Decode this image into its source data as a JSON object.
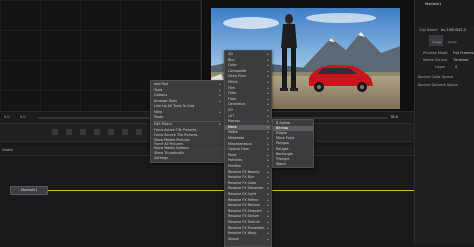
{
  "viewer": {
    "timecode": "78.0",
    "frame_start": "0.0",
    "frame_current": "0.0"
  },
  "inspector": {
    "node_name": "MediaIn1",
    "clip_label": "Clip Name",
    "clip_value": "ec-1000542.3",
    "tab_image": "Image",
    "tab_audio": "Audio",
    "rows": [
      {
        "label": "Process Mode",
        "value": "Full Frames"
      },
      {
        "label": "Media Source",
        "value": "Timeline"
      },
      {
        "label": "Layer",
        "value": "0"
      }
    ],
    "sections": [
      "Source Color Space",
      "Source Gamma Space"
    ]
  },
  "nodes": {
    "header": "Nodes",
    "media_in_label": "MediaIn1"
  },
  "context_menu": {
    "items": [
      {
        "label": "Add Tool",
        "arrow": true
      },
      {
        "label": "Tools",
        "arrow": true
      },
      {
        "label": "Options",
        "arrow": true
      },
      {
        "label": "Arrange Tools",
        "arrow": true
      },
      {
        "label": "Line Up All Tools To Grid",
        "arrow": false
      },
      {
        "label": "View",
        "arrow": true
      },
      {
        "label": "Paste",
        "arrow": false
      },
      {
        "label": "Edit Macro",
        "arrow": true
      },
      {
        "label": "Force Active Tile Pictures",
        "arrow": false
      },
      {
        "label": "Force Source Tile Pictures",
        "arrow": false
      },
      {
        "label": "Show Modes Pictures",
        "arrow": false
      },
      {
        "label": "Force All Pictures",
        "arrow": false
      },
      {
        "label": "Show Masks Options",
        "arrow": false
      },
      {
        "label": "Show Thumbnails",
        "arrow": false
      },
      {
        "label": "Settings",
        "arrow": false
      }
    ]
  },
  "tools_menu": {
    "items": [
      "3D",
      "Blur",
      "Color",
      "Composite",
      "Deep Pixel",
      "Effect",
      "Film",
      "Filter",
      "Flow",
      "Generator",
      "I/O",
      "LUT",
      "Macros",
      "Mask",
      "Matte",
      "Metadata",
      "Miscellaneous",
      "Optical Flow",
      "Paint",
      "Particles",
      "Position",
      "Resolve FX Beauty",
      "Resolve FX Blur",
      "Resolve FX Color",
      "Resolve FX Generate",
      "Resolve FX Light",
      "Resolve FX Refine",
      "Resolve FX Revival",
      "Resolve FX Sharpen",
      "Resolve FX Stylize",
      "Resolve FX Texture",
      "Resolve FX Transform",
      "Resolve FX Warp",
      "Shape"
    ],
    "highlight_index": 13
  },
  "mask_menu": {
    "items": [
      "B-Spline",
      "Bitmap",
      "Ellipse",
      "Mask Paint",
      "Polygon",
      "Ranges",
      "Rectangle",
      "Triangle",
      "Wand"
    ],
    "highlight_index": 1
  }
}
